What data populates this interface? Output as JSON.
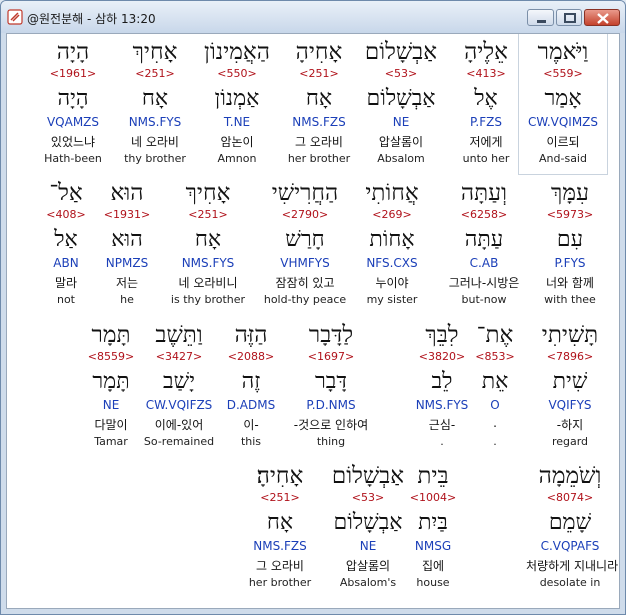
{
  "window": {
    "title": "@원전분해 - 삼하 13:20",
    "buttons": {
      "minimize": "minimize",
      "maximize": "maximize",
      "close": "close"
    }
  },
  "lines": [
    {
      "words": [
        {
          "hebrew": "וַיֹּאמֶר",
          "strong": "<559>",
          "lexeme": "אָמַר",
          "morph": "CW.VQIMZS",
          "korean": "이르되",
          "english": "And-said",
          "selected": true
        },
        {
          "hebrew": "אֵלֶיהָ",
          "strong": "<413>",
          "lexeme": "אֶל",
          "morph": "P.FZS",
          "korean": "저에게",
          "english": "unto her"
        },
        {
          "hebrew": "אַבְשָׁלוֹם",
          "strong": "<53>",
          "lexeme": "אַבְשָׁלוֹם",
          "morph": "NE",
          "korean": "압살롬이",
          "english": "Absalom"
        },
        {
          "hebrew": "אָחִיהָ",
          "strong": "<251>",
          "lexeme": "אָח",
          "morph": "NMS.FZS",
          "korean": "그 오라비",
          "english": "her brother"
        },
        {
          "hebrew": "הַאֲמִינוֹן",
          "strong": "<550>",
          "lexeme": "אַמְנוֹן",
          "morph": "T.NE",
          "korean": "암논이",
          "english": "Amnon"
        },
        {
          "hebrew": "אָחִיךְ",
          "strong": "<251>",
          "lexeme": "אָח",
          "morph": "NMS.FYS",
          "korean": "네 오라비",
          "english": "thy brother"
        },
        {
          "hebrew": "הָיָה",
          "strong": "<1961>",
          "lexeme": "הָיָה",
          "morph": "VQAMZS",
          "korean": "있었느냐",
          "english": "Hath-been"
        }
      ]
    },
    {
      "words": [
        {
          "hebrew": "עִמָּךְ",
          "strong": "<5973>",
          "lexeme": "עִם",
          "morph": "P.FYS",
          "korean": "너와 함께",
          "english": "with thee"
        },
        {
          "hebrew": "וְעַתָּה",
          "strong": "<6258>",
          "lexeme": "עַתָּה",
          "morph": "C.AB",
          "korean": "그러나-시방은",
          "english": "but-now"
        },
        {
          "hebrew": "אֲחוֹתִי",
          "strong": "<269>",
          "lexeme": "אָחוֹת",
          "morph": "NFS.CXS",
          "korean": "누이야",
          "english": "my sister"
        },
        {
          "hebrew": "הַחֲרִישִׁי",
          "strong": "<2790>",
          "lexeme": "חָרַשׁ",
          "morph": "VHMFYS",
          "korean": "잠잠히 있고",
          "english": "hold-thy peace"
        },
        {
          "hebrew": "אָחִיךְ",
          "strong": "<251>",
          "lexeme": "אָח",
          "morph": "NMS.FYS",
          "korean": "네 오라비니",
          "english": "is thy brother"
        },
        {
          "hebrew": "הוּא",
          "strong": "<1931>",
          "lexeme": "הוּא",
          "morph": "NPMZS",
          "korean": "저는",
          "english": "he"
        },
        {
          "hebrew": "אַל־",
          "strong": "<408>",
          "lexeme": "אַל",
          "morph": "ABN",
          "korean": "말라",
          "english": "not"
        }
      ]
    },
    {
      "words": [
        {
          "hebrew": "תָּשִׁיתִי",
          "strong": "<7896>",
          "lexeme": "שִׁית",
          "morph": "VQIFYS",
          "korean": "-하지",
          "english": "regard"
        },
        {
          "hebrew": "אֶת־",
          "strong": "<853>",
          "lexeme": "אֵת",
          "morph": "O",
          "korean": ".",
          "english": "."
        },
        {
          "hebrew": "לִבֵּךְ",
          "strong": "<3820>",
          "lexeme": "לֵב",
          "morph": "NMS.FYS",
          "korean": "근심-",
          "english": "."
        },
        {
          "hebrew": "לַדָּבָר",
          "strong": "<1697>",
          "lexeme": "דָּבָר",
          "morph": "P.D.NMS",
          "korean": "-것으로 인하여",
          "english": "thing"
        },
        {
          "hebrew": "הַזֶּה",
          "strong": "<2088>",
          "lexeme": "זֶה",
          "morph": "D.ADMS",
          "korean": "이-",
          "english": "this"
        },
        {
          "hebrew": "וַתֵּשֶׁב",
          "strong": "<3427>",
          "lexeme": "יָשַׁב",
          "morph": "CW.VQIFZS",
          "korean": "이에-있어",
          "english": "So-remained"
        },
        {
          "hebrew": "תָּמָר",
          "strong": "<8559>",
          "lexeme": "תָּמָר",
          "morph": "NE",
          "korean": "다말이",
          "english": "Tamar"
        }
      ]
    },
    {
      "words": [
        {
          "hebrew": "וְשֹׁמֵמָה",
          "strong": "<8074>",
          "lexeme": "שָׁמֵם",
          "morph": "C.VQPAFS",
          "korean": "처량하게 지내니라",
          "english": "desolate in"
        },
        {
          "hebrew": "בֵּית",
          "strong": "<1004>",
          "lexeme": "בַּיִת",
          "morph": "NMSG",
          "korean": "집에",
          "english": "house"
        },
        {
          "hebrew": "אַבְשָׁלוֹם",
          "strong": "<53>",
          "lexeme": "אַבְשָׁלוֹם",
          "morph": "NE",
          "korean": "압살롬의",
          "english": "Absalom's"
        },
        {
          "hebrew": "אָחִיהָ׃",
          "strong": "<251>",
          "lexeme": "אָח",
          "morph": "NMS.FZS",
          "korean": "그 오라비",
          "english": "her brother"
        }
      ]
    }
  ],
  "colors": {
    "strong": "#b0121b",
    "morph": "#1b3fb8",
    "text": "#111111"
  }
}
